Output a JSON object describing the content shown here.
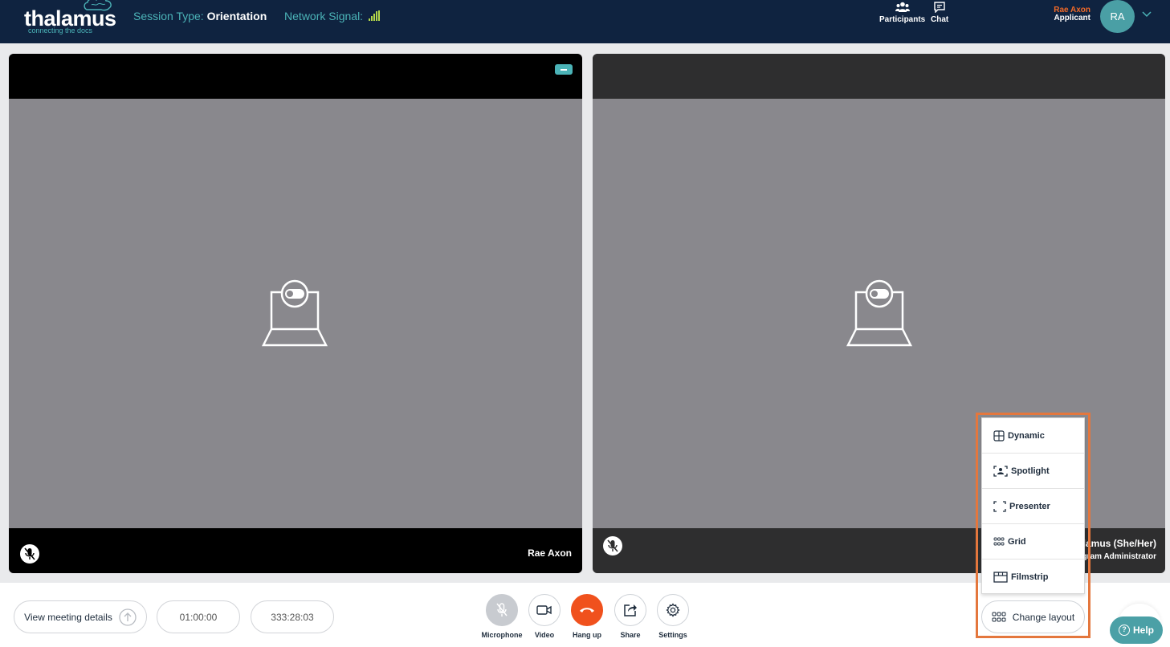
{
  "header": {
    "logo_text": "thalamus",
    "logo_tagline": "connecting the docs",
    "session_type_label": "Session Type:",
    "session_type_value": "Orientation",
    "network_signal_label": "Network Signal:",
    "participants_label": "Participants",
    "chat_label": "Chat",
    "user_name": "Rae Axon",
    "user_role": "Applicant",
    "avatar_initials": "RA"
  },
  "tiles": [
    {
      "name": "Rae Axon",
      "role": ""
    },
    {
      "name": "lamus (She/Her)",
      "role": "gram Administrator"
    }
  ],
  "layout_menu": {
    "items": [
      {
        "label": "Dynamic",
        "icon": "dynamic-layout-icon"
      },
      {
        "label": "Spotlight",
        "icon": "spotlight-layout-icon"
      },
      {
        "label": "Presenter",
        "icon": "presenter-layout-icon"
      },
      {
        "label": "Grid",
        "icon": "grid-layout-icon"
      },
      {
        "label": "Filmstrip",
        "icon": "filmstrip-layout-icon"
      }
    ],
    "change_layout_label": "Change layout"
  },
  "footer": {
    "view_meeting_details": "View meeting details",
    "timer_1": "01:00:00",
    "timer_2": "333:28:03",
    "controls": {
      "microphone": "Microphone",
      "video": "Video",
      "hang_up": "Hang up",
      "share": "Share",
      "settings": "Settings"
    },
    "help_label": "Help"
  },
  "colors": {
    "header_bg": "#0f2340",
    "accent_teal": "#4bb3b7",
    "accent_orange": "#f26a28",
    "hangup_red": "#f0511d",
    "tile_grey": "#89888d",
    "highlight_orange": "#e4773d"
  }
}
